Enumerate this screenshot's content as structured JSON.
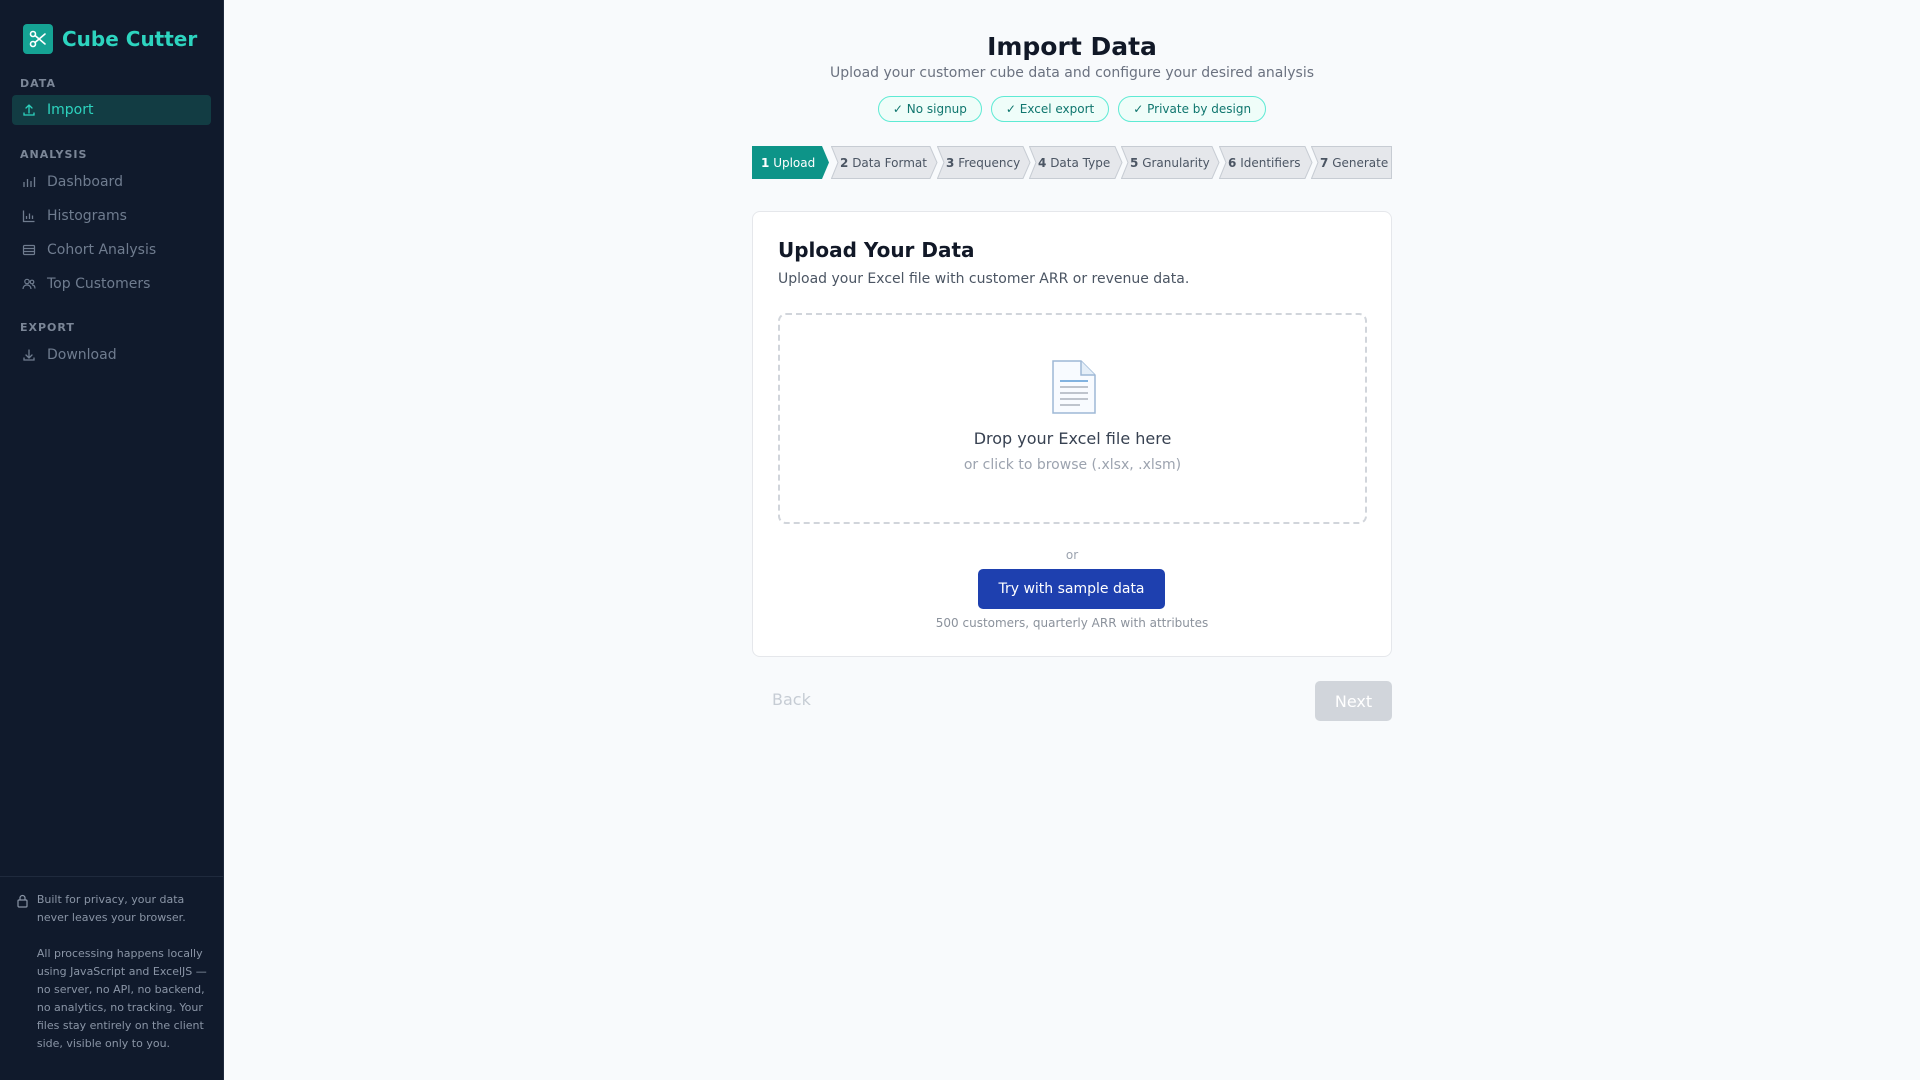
{
  "app": {
    "name": "Cube Cutter",
    "accent": "#2dd4bf",
    "brand_color": "#15a394",
    "logo_icon": "scissors-icon"
  },
  "sidebar": {
    "sections": [
      {
        "label": "DATA",
        "items": [
          {
            "label": "Import",
            "icon": "upload-icon",
            "active": true
          }
        ]
      },
      {
        "label": "ANALYSIS",
        "items": [
          {
            "label": "Dashboard",
            "icon": "bar-chart-icon",
            "active": false
          },
          {
            "label": "Histograms",
            "icon": "histogram-icon",
            "active": false
          },
          {
            "label": "Cohort Analysis",
            "icon": "table-icon",
            "active": false
          },
          {
            "label": "Top Customers",
            "icon": "users-icon",
            "active": false
          }
        ]
      },
      {
        "label": "EXPORT",
        "items": [
          {
            "label": "Download",
            "icon": "download-icon",
            "active": false
          }
        ]
      }
    ],
    "footer": {
      "icon": "lock-icon",
      "line1": "Built for privacy, your data never leaves your browser.",
      "line2": "All processing happens locally using JavaScript and ExcelJS — no server, no API, no backend, no analytics, no tracking. Your files stay entirely on the client side, visible only to you."
    }
  },
  "header": {
    "title": "Import Data",
    "subtitle": "Upload your customer cube data and configure your desired analysis",
    "badges": [
      "✓ No signup",
      "✓ Excel export",
      "✓ Private by design"
    ]
  },
  "stepper": {
    "steps": [
      {
        "num": "1",
        "label": "Upload",
        "active": true
      },
      {
        "num": "2",
        "label": "Data Format",
        "active": false
      },
      {
        "num": "3",
        "label": "Frequency",
        "active": false
      },
      {
        "num": "4",
        "label": "Data Type",
        "active": false
      },
      {
        "num": "5",
        "label": "Granularity",
        "active": false
      },
      {
        "num": "6",
        "label": "Identifiers",
        "active": false
      },
      {
        "num": "7",
        "label": "Generate",
        "active": false
      }
    ]
  },
  "card": {
    "title": "Upload Your Data",
    "description": "Upload your Excel file with customer ARR or revenue data.",
    "dropzone": {
      "icon": "document-icon",
      "main_text": "Drop your Excel file here",
      "sub_text": "or click to browse (.xlsx, .xlsm)"
    },
    "or_text": "or",
    "sample_button": "Try with sample data",
    "sample_caption": "500 customers, quarterly ARR with attributes"
  },
  "nav": {
    "back_label": "Back",
    "next_label": "Next"
  }
}
